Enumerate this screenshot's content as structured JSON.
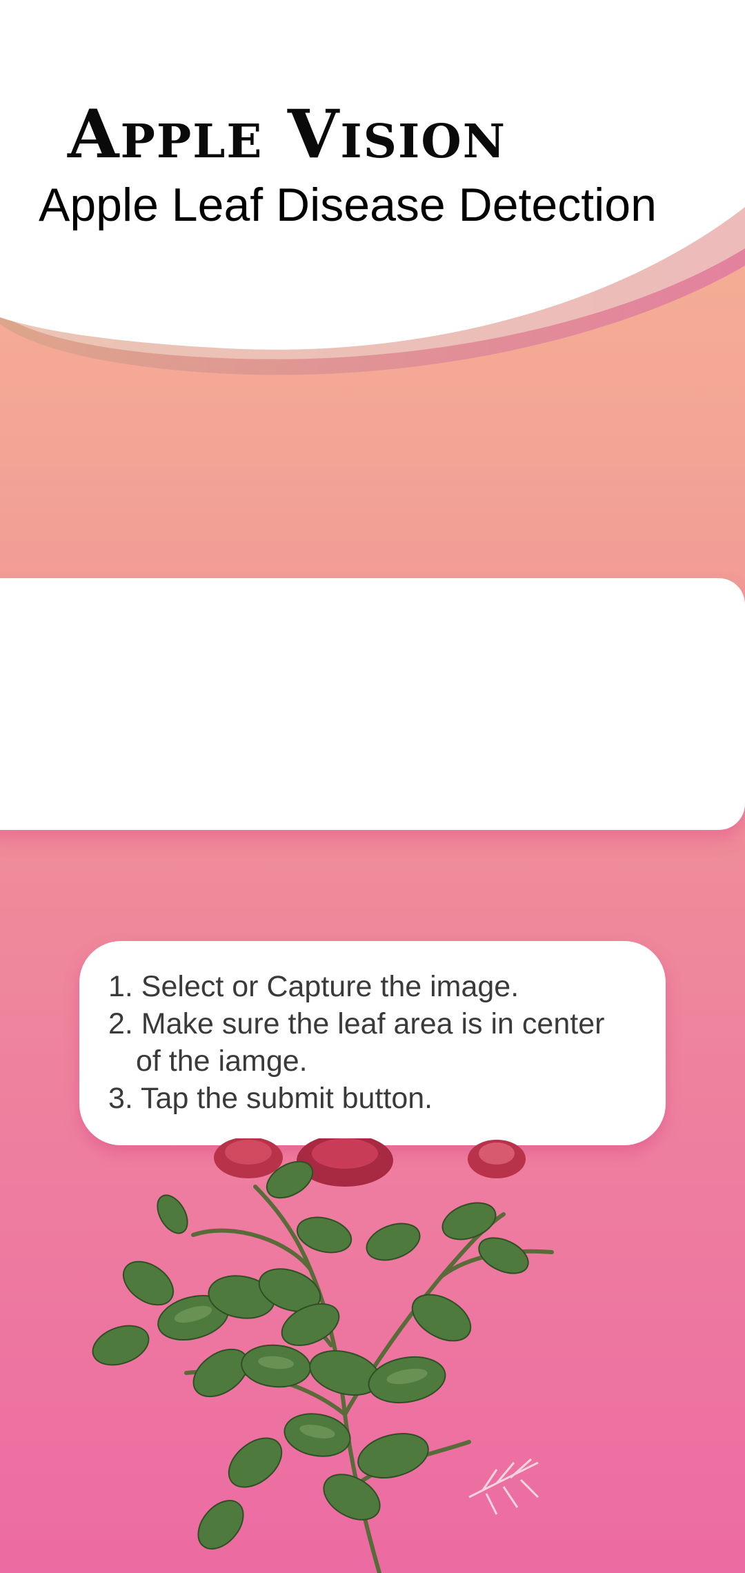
{
  "header": {
    "title": "Apple Vision",
    "subtitle": "Apple Leaf Disease Detection"
  },
  "instructions": {
    "line1": "1. Select or Capture the image.",
    "line2": "2. Make sure the leaf area is in center",
    "line3": "of the iamge.",
    "line4": "3. Tap the submit button."
  },
  "colors": {
    "gradient_top": "#f6b894",
    "gradient_bottom": "#ec6ba2",
    "card_background": "#ffffff",
    "leaf_green": "#4f7a3d",
    "rose_red": "#b8324a"
  },
  "icons": {
    "decoration": "rose-branch-illustration"
  }
}
